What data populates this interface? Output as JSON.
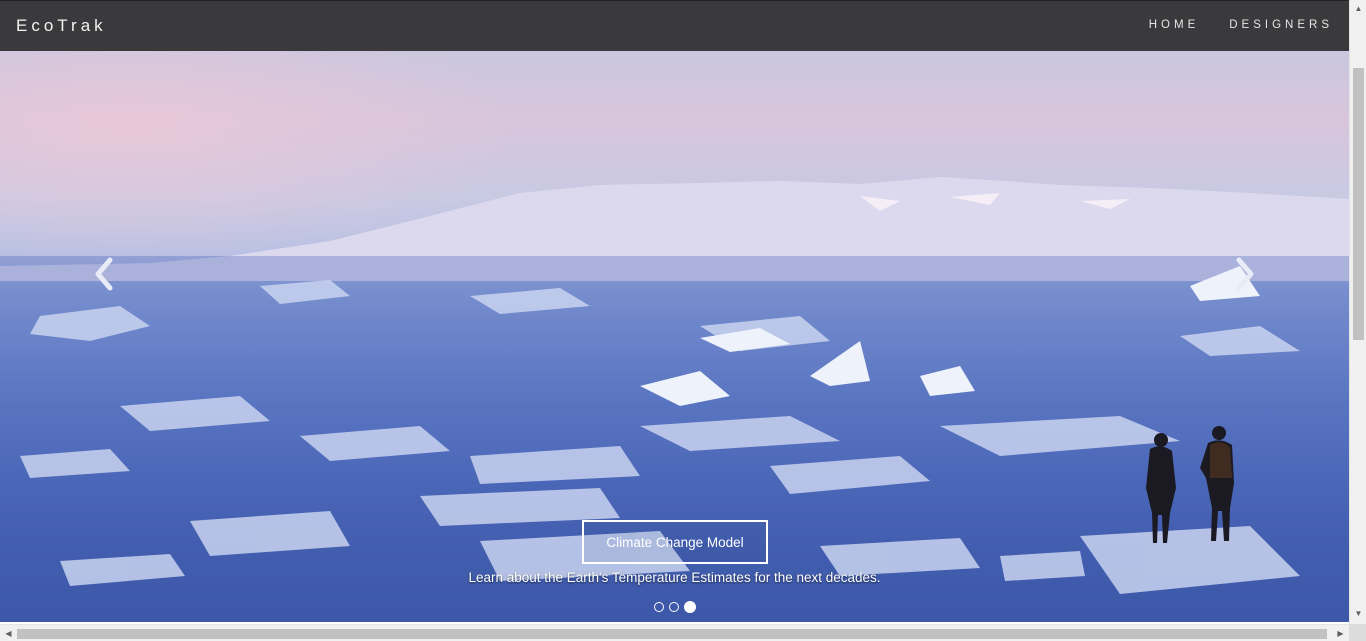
{
  "navbar": {
    "brand": "EcoTrak",
    "links": [
      {
        "label": "HOME"
      },
      {
        "label": "DESIGNERS"
      }
    ]
  },
  "carousel": {
    "slide_image": "arctic-ice-floes-with-two-people",
    "caption_button": "Climate Change Model",
    "caption_text": "Learn about the Earth's Temperature Estimates for the next decades.",
    "indicators": {
      "count": 3,
      "active_index": 2
    },
    "prev_icon": "chevron-left-icon",
    "next_icon": "chevron-right-icon"
  },
  "scrollbars": {
    "vertical": "visible",
    "horizontal": "visible"
  },
  "colors": {
    "navbar_bg": "#3a3a3c",
    "nav_text": "#e6e6e6",
    "caption_border": "#ffffff"
  }
}
